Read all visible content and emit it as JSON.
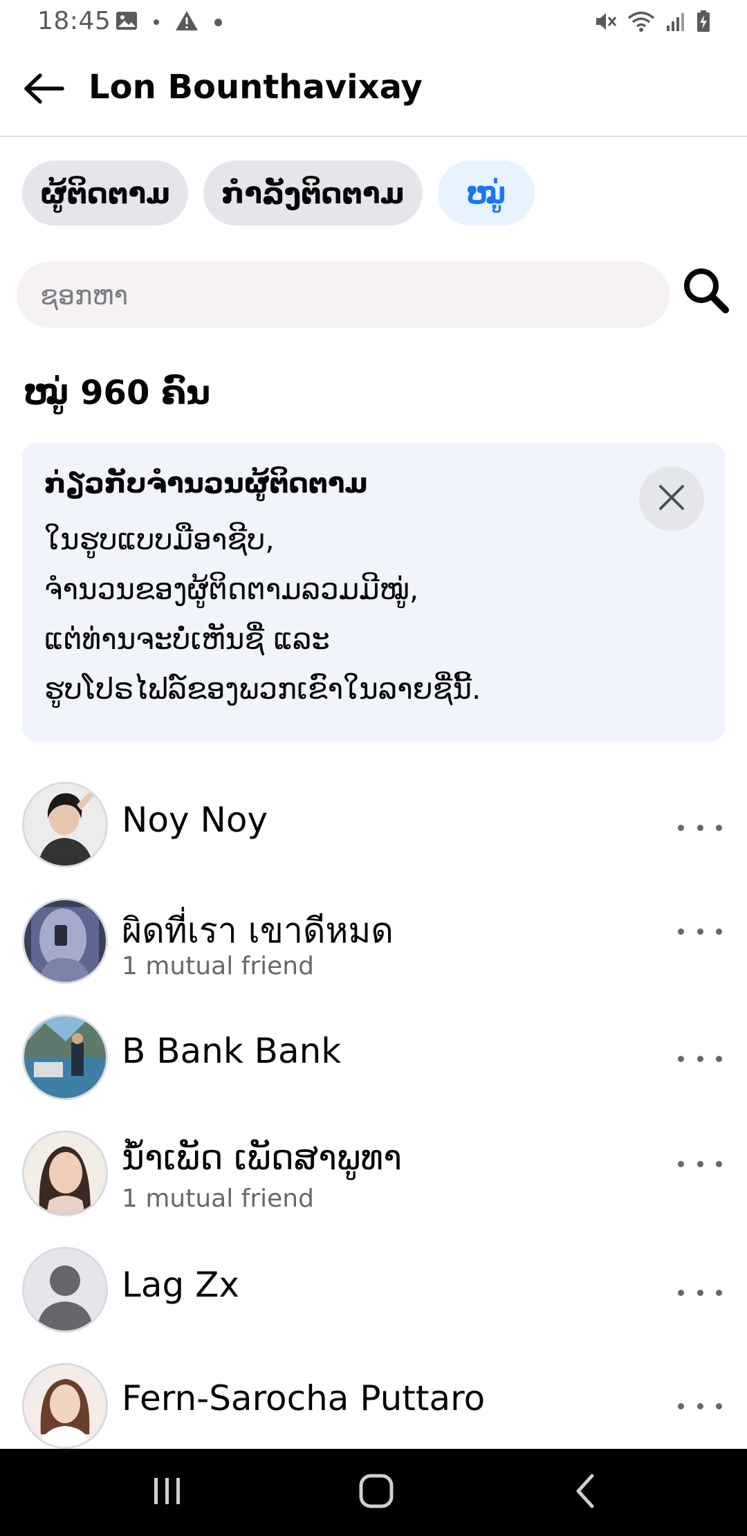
{
  "status_bar": {
    "time": "18:45",
    "icons": [
      "image-icon",
      "warning-icon",
      "mute-icon",
      "wifi-icon",
      "signal-icon",
      "battery-icon"
    ]
  },
  "header": {
    "title": "Lon Bounthavixay"
  },
  "tabs": [
    {
      "label": "ຜູ້ຕິດຕາມ",
      "active": false
    },
    {
      "label": "ກຳລັງຕິດຕາມ",
      "active": false
    },
    {
      "label": "ໝູ່",
      "active": true
    }
  ],
  "search": {
    "placeholder": "ຊອກຫາ"
  },
  "friend_count": "ໝູ່ 960 ຄົນ",
  "info_card": {
    "title": "ກ່ຽວກັບຈຳນວນຜູ້ຕິດຕາມ",
    "body_lines": [
      "ໃນຮູບແບບມືອາຊີບ,",
      "ຈຳນວນຂອງຜູ້ຕິດຕາມລວມມີໝູ່,",
      "ແຕ່ທ່ານຈະບໍ່ເຫັນຊື່ ແລະ",
      "ຮູບໂປຣໄຟລ໌ຂອງພວກເຂົາໃນລາຍຊື່ນີ້."
    ]
  },
  "friends": [
    {
      "name": "Noy Noy",
      "subtitle": ""
    },
    {
      "name": "ผิดที่เรา เขาดีหมด",
      "subtitle": "1 mutual friend"
    },
    {
      "name": "B Bank Bank",
      "subtitle": ""
    },
    {
      "name": "ນ້ຳເພັດ ເພັດສາພູທາ",
      "subtitle": "1 mutual friend"
    },
    {
      "name": "Lag Zx",
      "subtitle": ""
    },
    {
      "name": "Fern-Sarocha Puttaro",
      "subtitle": ""
    }
  ],
  "colors": {
    "accent": "#1877f2",
    "active_tab_bg": "#e7f3ff",
    "tab_bg": "#e4e6eb",
    "info_card_bg": "#f0f4fb",
    "secondary_text": "#65676b"
  }
}
